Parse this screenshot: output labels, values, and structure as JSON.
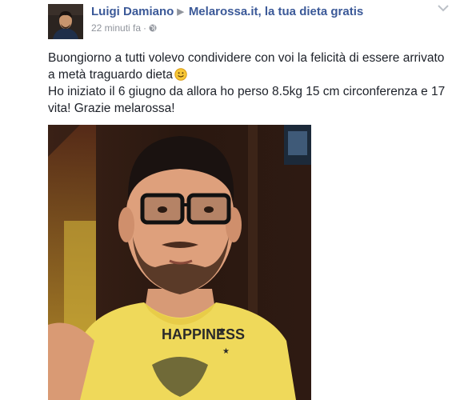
{
  "post": {
    "author": "Luigi Damiano",
    "target_page": "Melarossa.it, la tua dieta gratis",
    "timestamp": "22 minuti fa",
    "separator": "·",
    "privacy_icon": "globe-icon",
    "options_icon": "chevron-down-icon",
    "text_line1": "Buongiorno a tutti volevo condividere con voi la felicità di essere arrivato a metà traguardo dieta",
    "emoji": "smiley-icon",
    "text_line2": "Ho iniziato il 6 giugno da allora ho perso 8.5kg 15 cm circonferenza e 17 vita! Grazie melarossa!",
    "photo_shirt_text": "HAPPINESS"
  },
  "colors": {
    "link": "#3b5998",
    "text": "#1d2129",
    "meta": "#90949c",
    "shirt": "#f2e15a"
  }
}
